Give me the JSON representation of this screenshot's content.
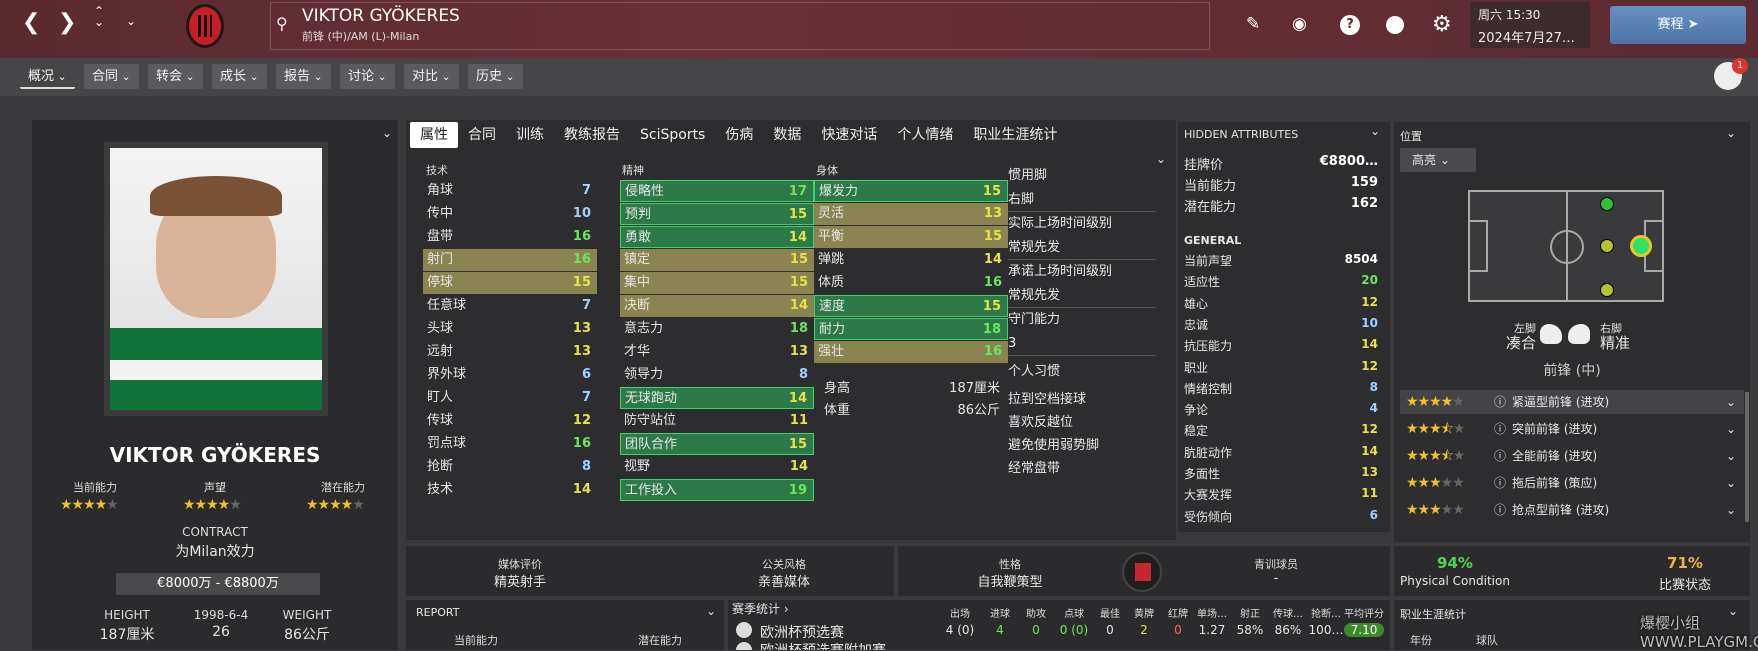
{
  "header": {
    "player_name": "VIKTOR GYÖKERES",
    "position_club": "前锋 (中)/AM (L)-Milan",
    "day_time": "周六 15:30",
    "date": "2024年7月27…",
    "continue_label": "赛程",
    "notification_count": "1"
  },
  "menu": [
    "概况",
    "合同",
    "转会",
    "成长",
    "报告",
    "讨论",
    "对比",
    "历史"
  ],
  "tabs": [
    "属性",
    "合同",
    "训练",
    "教练报告",
    "SciSports",
    "伤病",
    "数据",
    "快速对话",
    "个人情绪",
    "职业生涯统计"
  ],
  "profile": {
    "name": "VIKTOR GYÖKERES",
    "labels": [
      "当前能力",
      "声望",
      "潜在能力"
    ],
    "stars": [
      4,
      4,
      4
    ],
    "contract_label": "CONTRACT",
    "contract_value": "为Milan效力",
    "wage": "€8000万 - €8800万",
    "height_label": "HEIGHT",
    "height": "187厘米",
    "dob": "1998-6-4",
    "age": "26",
    "weight_label": "WEIGHT",
    "weight": "86公斤"
  },
  "attributes": {
    "technical_title": "技术",
    "mental_title": "精神",
    "physical_title": "身体",
    "technical": [
      {
        "n": "角球",
        "v": "7",
        "hl": "none",
        "c": "lblue"
      },
      {
        "n": "传中",
        "v": "10",
        "hl": "none",
        "c": "lblue"
      },
      {
        "n": "盘带",
        "v": "16",
        "hl": "none",
        "c": "green"
      },
      {
        "n": "射门",
        "v": "16",
        "hl": "yellow",
        "c": "green"
      },
      {
        "n": "停球",
        "v": "15",
        "hl": "yellow",
        "c": "yellow"
      },
      {
        "n": "任意球",
        "v": "7",
        "hl": "none",
        "c": "lblue"
      },
      {
        "n": "头球",
        "v": "13",
        "hl": "none",
        "c": "yellow"
      },
      {
        "n": "远射",
        "v": "13",
        "hl": "none",
        "c": "yellow"
      },
      {
        "n": "界外球",
        "v": "6",
        "hl": "none",
        "c": "lblue"
      },
      {
        "n": "盯人",
        "v": "7",
        "hl": "none",
        "c": "lblue"
      },
      {
        "n": "传球",
        "v": "12",
        "hl": "none",
        "c": "yellow"
      },
      {
        "n": "罚点球",
        "v": "16",
        "hl": "none",
        "c": "green"
      },
      {
        "n": "抢断",
        "v": "8",
        "hl": "none",
        "c": "lblue"
      },
      {
        "n": "技术",
        "v": "14",
        "hl": "none",
        "c": "yellow"
      }
    ],
    "mental": [
      {
        "n": "侵略性",
        "v": "17",
        "hl": "green",
        "c": "green"
      },
      {
        "n": "预判",
        "v": "15",
        "hl": "green",
        "c": "yellow"
      },
      {
        "n": "勇敢",
        "v": "14",
        "hl": "green",
        "c": "yellow"
      },
      {
        "n": "镇定",
        "v": "15",
        "hl": "yellow",
        "c": "yellow"
      },
      {
        "n": "集中",
        "v": "15",
        "hl": "yellow",
        "c": "yellow"
      },
      {
        "n": "决断",
        "v": "14",
        "hl": "yellow",
        "c": "yellow"
      },
      {
        "n": "意志力",
        "v": "18",
        "hl": "none",
        "c": "green"
      },
      {
        "n": "才华",
        "v": "13",
        "hl": "none",
        "c": "yellow"
      },
      {
        "n": "领导力",
        "v": "8",
        "hl": "none",
        "c": "lblue"
      },
      {
        "n": "无球跑动",
        "v": "14",
        "hl": "green",
        "c": "yellow"
      },
      {
        "n": "防守站位",
        "v": "11",
        "hl": "none",
        "c": "yellow"
      },
      {
        "n": "团队合作",
        "v": "15",
        "hl": "green",
        "c": "yellow"
      },
      {
        "n": "视野",
        "v": "14",
        "hl": "none",
        "c": "yellow"
      },
      {
        "n": "工作投入",
        "v": "19",
        "hl": "green",
        "c": "green"
      }
    ],
    "physical": [
      {
        "n": "爆发力",
        "v": "15",
        "hl": "green",
        "c": "yellow"
      },
      {
        "n": "灵活",
        "v": "13",
        "hl": "yellow",
        "c": "yellow"
      },
      {
        "n": "平衡",
        "v": "15",
        "hl": "yellow",
        "c": "yellow"
      },
      {
        "n": "弹跳",
        "v": "14",
        "hl": "none",
        "c": "yellow"
      },
      {
        "n": "体质",
        "v": "16",
        "hl": "none",
        "c": "green"
      },
      {
        "n": "速度",
        "v": "15",
        "hl": "green",
        "c": "yellow"
      },
      {
        "n": "耐力",
        "v": "18",
        "hl": "green",
        "c": "green"
      },
      {
        "n": "强壮",
        "v": "16",
        "hl": "yellow",
        "c": "green"
      }
    ],
    "height_label": "身高",
    "height": "187厘米",
    "weight_label": "体重",
    "weight": "86公斤"
  },
  "info": {
    "foot_label": "惯用脚",
    "foot": "右脚",
    "playtime_label": "实际上场时间级别",
    "playtime": "常规先发",
    "promised_label": "承诺上场时间级别",
    "promised": "常规先发",
    "gk_label": "守门能力",
    "gk": "3",
    "habits_label": "个人习惯",
    "habits": [
      "拉到空档接球",
      "喜欢反越位",
      "避免使用弱势脚",
      "经常盘带"
    ]
  },
  "hidden": {
    "title": "HIDDEN ATTRIBUTES",
    "rows": [
      {
        "n": "挂牌价",
        "v": "€8800…",
        "c": "white"
      },
      {
        "n": "当前能力",
        "v": "159",
        "c": "white"
      },
      {
        "n": "潜在能力",
        "v": "162",
        "c": "white"
      }
    ],
    "general_title": "GENERAL",
    "general": [
      {
        "n": "当前声望",
        "v": "8504",
        "c": "white"
      },
      {
        "n": "适应性",
        "v": "20",
        "c": "green"
      },
      {
        "n": "雄心",
        "v": "12",
        "c": "yellow"
      },
      {
        "n": "忠诚",
        "v": "10",
        "c": "lblue"
      },
      {
        "n": "抗压能力",
        "v": "14",
        "c": "yellow"
      },
      {
        "n": "职业",
        "v": "12",
        "c": "yellow"
      },
      {
        "n": "情绪控制",
        "v": "8",
        "c": "lblue"
      },
      {
        "n": "争论",
        "v": "4",
        "c": "lblue"
      },
      {
        "n": "稳定",
        "v": "12",
        "c": "yellow"
      },
      {
        "n": "肮脏动作",
        "v": "14",
        "c": "yellow"
      },
      {
        "n": "多面性",
        "v": "13",
        "c": "yellow"
      },
      {
        "n": "大赛发挥",
        "v": "11",
        "c": "yellow"
      },
      {
        "n": "受伤倾向",
        "v": "6",
        "c": "lblue"
      }
    ]
  },
  "position": {
    "title": "位置",
    "dropdown": "高亮",
    "left_foot_label": "左脚",
    "left_foot": "凑合",
    "right_foot_label": "右脚",
    "right_foot": "精准",
    "main_position": "前锋 (中)",
    "roles": [
      {
        "stars": 4,
        "half": false,
        "name": "紧逼型前锋 (进攻)"
      },
      {
        "stars": 3,
        "half": true,
        "name": "突前前锋 (进攻)"
      },
      {
        "stars": 3,
        "half": true,
        "name": "全能前锋 (进攻)"
      },
      {
        "stars": 3,
        "half": false,
        "name": "拖后前锋 (策应)"
      },
      {
        "stars": 3,
        "half": false,
        "name": "抢点型前锋 (进攻)"
      }
    ]
  },
  "bottom": {
    "media_label": "媒体评价",
    "media_value": "精英射手",
    "pr_label": "公关风格",
    "pr_value": "亲善媒体",
    "personality_label": "性格",
    "personality_value": "自我鞭策型",
    "youth_label": "青训球员",
    "youth_value": "-",
    "condition_pct": "94%",
    "condition_label": "Physical Condition",
    "match_pct": "71%",
    "match_label": "比赛状态",
    "report_title": "REPORT",
    "report_cols": [
      "当前能力",
      "潜在能力"
    ],
    "stats_title": "赛季统计",
    "stats_headers": [
      "出场",
      "进球",
      "助攻",
      "点球",
      "最佳",
      "黄牌",
      "红牌",
      "单场…",
      "射正",
      "传球…",
      "抢断…",
      "平均评分"
    ],
    "stats_row_name": "欧洲杯预选赛",
    "stats_row": [
      "4 (0)",
      "4",
      "0",
      "0 (0)",
      "0",
      "2",
      "0",
      "1.27",
      "58%",
      "86%",
      "100…",
      "7.10"
    ],
    "stats_row2": "欧洲杯预选赛附加赛",
    "career_title": "职业生涯统计",
    "career_cols": [
      "年份",
      "球队"
    ]
  },
  "watermark": "爆樱小组 WWW.PLAYGM.CC"
}
